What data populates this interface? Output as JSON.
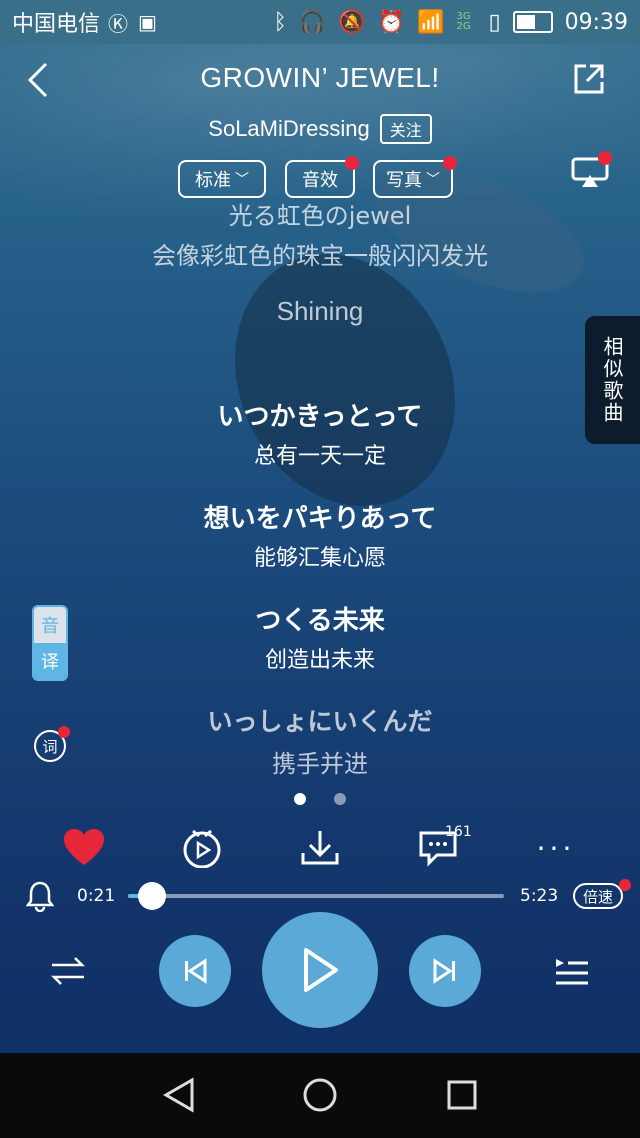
{
  "status_bar": {
    "carrier": "中国电信",
    "time": "09:39",
    "network": "3G 2G"
  },
  "header": {
    "title": "GROWIN’ JEWEL!",
    "artist": "SoLaMiDressing",
    "follow_label": "关注"
  },
  "options": {
    "quality_label": "标准",
    "effect_label": "音效",
    "photo_label": "写真"
  },
  "side_tab": {
    "label": "相似歌曲"
  },
  "lyrics": [
    {
      "original": "光る虹色のjewel",
      "translation": "会像彩虹色的珠宝一般闪闪发光"
    },
    {
      "original": "Shining",
      "translation": ""
    },
    {
      "original": "いつかきっとって",
      "translation": "总有一天一定"
    },
    {
      "original": "想いをパキりあって",
      "translation": "能够汇集心愿"
    },
    {
      "original": "つくる未来",
      "translation": "创造出未来"
    },
    {
      "original": "いっしょにいくんだ",
      "translation": "携手并进"
    }
  ],
  "lyric_tools": {
    "phonetic": "音",
    "translate": "译",
    "lyric": "词"
  },
  "actions": {
    "comment_count": "161"
  },
  "progress": {
    "current": "0:21",
    "total": "5:23",
    "fraction": 0.065,
    "speed_label": "倍速"
  },
  "colors": {
    "accent": "#5aa9d6",
    "like": "#e8263a",
    "red_dot": "#e8263a"
  }
}
